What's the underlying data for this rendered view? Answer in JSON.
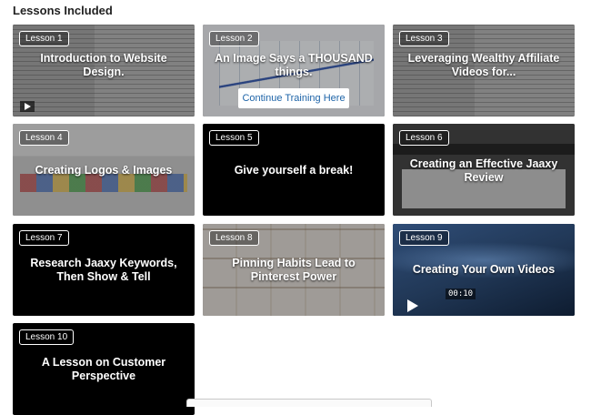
{
  "section": {
    "heading": "Lessons Included"
  },
  "lessons": [
    {
      "badge": "Lesson 1",
      "title": "Introduction to Website Design."
    },
    {
      "badge": "Lesson 2",
      "title": "An Image Says a THOUSAND things.",
      "cta": "Continue Training Here"
    },
    {
      "badge": "Lesson 3",
      "title": "Leveraging Wealthy Affiliate Videos for..."
    },
    {
      "badge": "Lesson 4",
      "title": "Creating Logos & Images"
    },
    {
      "badge": "Lesson 5",
      "title": "Give yourself a break!"
    },
    {
      "badge": "Lesson 6",
      "title": "Creating an Effective Jaaxy Review"
    },
    {
      "badge": "Lesson 7",
      "title": "Research Jaaxy Keywords, Then Show & Tell"
    },
    {
      "badge": "Lesson 8",
      "title": "Pinning Habits Lead to Pinterest Power"
    },
    {
      "badge": "Lesson 9",
      "title": "Creating Your Own Videos",
      "timecode": "00:10"
    },
    {
      "badge": "Lesson 10",
      "title": "A Lesson on Customer Perspective"
    }
  ]
}
